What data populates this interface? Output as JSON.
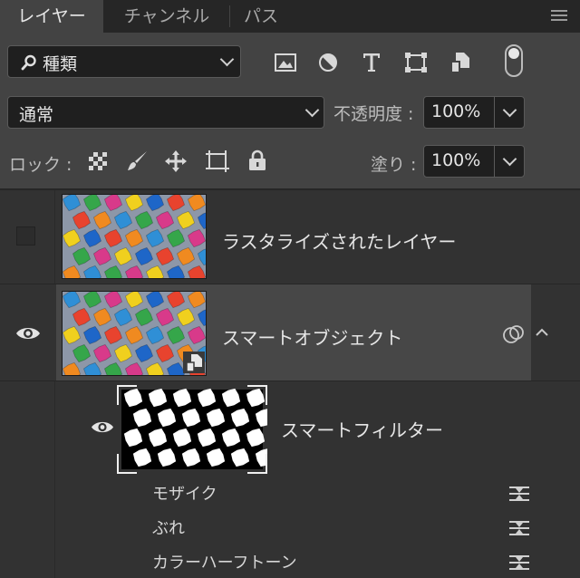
{
  "tabs": [
    {
      "label": "レイヤー",
      "active": true
    },
    {
      "label": "チャンネル",
      "active": false
    },
    {
      "label": "パス",
      "active": false
    }
  ],
  "filter": {
    "kind_label": "種類"
  },
  "blend": {
    "mode": "通常",
    "opacity_label": "不透明度 :",
    "opacity_value": "100%"
  },
  "lock": {
    "label": "ロック :",
    "fill_label": "塗り :",
    "fill_value": "100%"
  },
  "layers": [
    {
      "name": "ラスタライズされたレイヤー",
      "visible": false
    },
    {
      "name": "スマートオブジェクト",
      "visible": true,
      "selected": true
    }
  ],
  "smart_filter": {
    "label": "スマートフィルター"
  },
  "filters": [
    "モザイク",
    "ぶれ",
    "カラーハーフトーン"
  ],
  "colors": {
    "panel_bg": "#323232",
    "tab_bg": "#262626",
    "active_tab": "#434343",
    "selected_layer": "#474747"
  }
}
